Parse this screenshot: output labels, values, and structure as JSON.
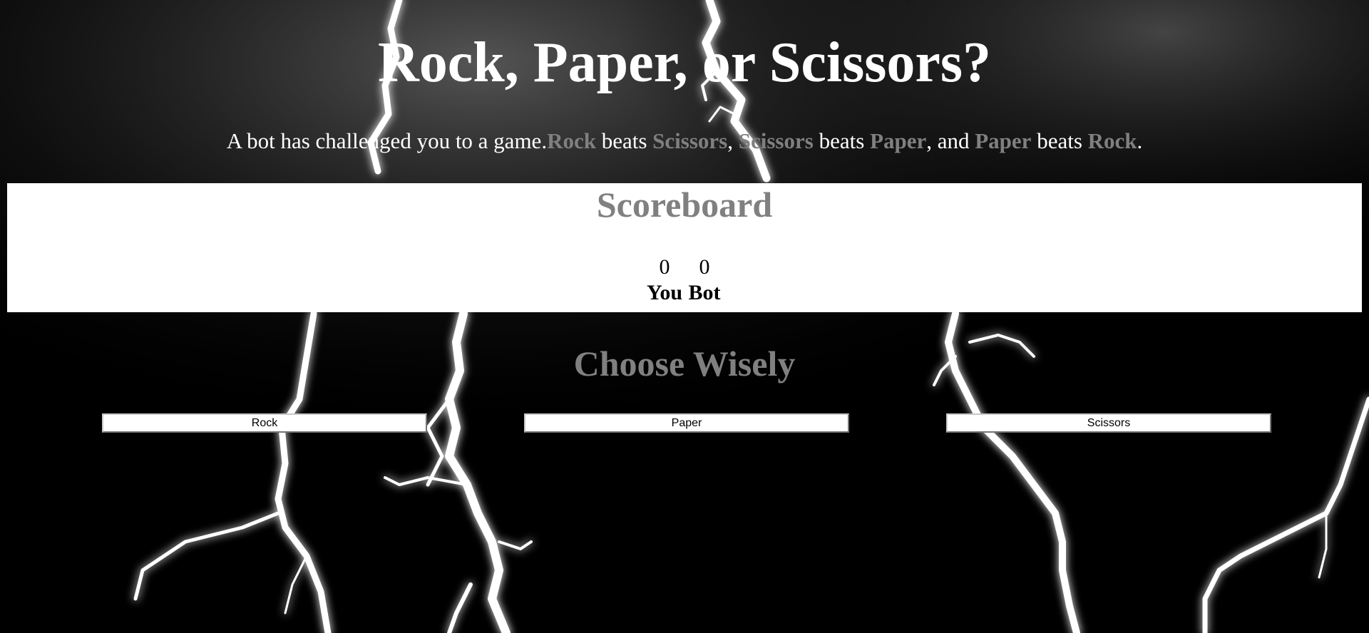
{
  "title": "Rock, Paper, or Scissors?",
  "intro": {
    "lead": "A bot has challenged you to a game.",
    "rock_1": "Rock",
    "beats_1": " beats ",
    "scissors_1": "Scissors",
    "comma": ", ",
    "scissors_2": "Scissors",
    "beats_2": " beats ",
    "paper_1": "Paper",
    "and": ", and ",
    "paper_2": "Paper",
    "beats_3": " beats ",
    "rock_2": "Rock",
    "period": "."
  },
  "scoreboard": {
    "heading": "Scoreboard",
    "you_score": "0",
    "bot_score": "0",
    "you_label": "You",
    "bot_label": "Bot"
  },
  "choose": {
    "heading": "Choose Wisely",
    "buttons": [
      "Rock",
      "Paper",
      "Scissors"
    ]
  },
  "colors": {
    "background": "#000000",
    "accent_gray": "#808080",
    "text_white": "#ffffff"
  }
}
